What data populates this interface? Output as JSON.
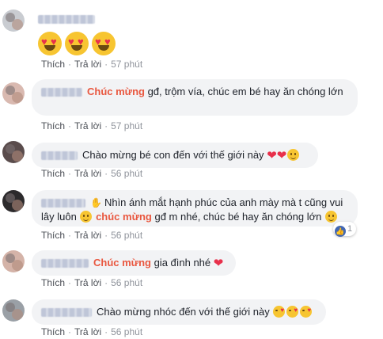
{
  "actions": {
    "like": "Thích",
    "reply": "Trả lời",
    "separator": "·"
  },
  "comments": [
    {
      "time": "57 phút",
      "emoji_count": 3
    },
    {
      "highlight": "Chúc mừng",
      "text": " gđ, trộm vía, chúc em bé hay ăn chóng lớn",
      "time": "57 phút"
    },
    {
      "text": "Chào mừng bé con đến với thế giới này",
      "time": "56 phút"
    },
    {
      "text_line1": "Nhìn ánh mắt hạnh phúc của anh mày mà t cũng vui",
      "text_line2_pre": "lây luôn",
      "highlight": "chúc mừng",
      "text_line2_post": " gđ m nhé, chúc bé hay ăn chóng lớn",
      "time": "56 phút",
      "reaction_count": "1"
    },
    {
      "highlight": "Chúc mừng",
      "text": " gia đình nhé",
      "time": "56 phút"
    },
    {
      "text": "Chào mừng nhóc đến với thế giới này",
      "time": "56 phút"
    }
  ],
  "icons": [
    "heart-eyes-emoji-icon",
    "heart-icon",
    "smile-emoji-icon",
    "kiss-emoji-icon",
    "like-icon",
    "wave-icon"
  ],
  "colors": {
    "highlight": "#e9573f",
    "bubble": "#f2f3f5",
    "like_blue": "#4267b2",
    "meta": "#90949c"
  }
}
